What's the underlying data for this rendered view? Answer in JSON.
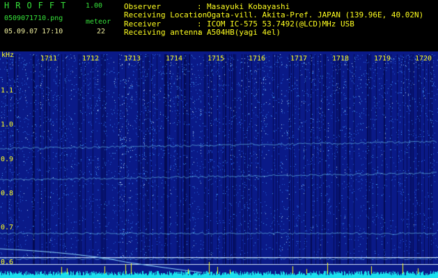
{
  "header": {
    "brand": "HROFFT",
    "version": "1.00",
    "filename": "0509071710.png",
    "object_type": "meteor",
    "datetime": "05.09.07 17:10",
    "count": "22"
  },
  "info": [
    {
      "label": "Observer",
      "value": "Masayuki Kobayashi"
    },
    {
      "label": "Receiving Location",
      "value": "Ogata-vill. Akita-Pref. JAPAN (139.96E, 40.02N)"
    },
    {
      "label": "Receiver",
      "value": "ICOM IC-575 53.7492(@LCD)MHz USB"
    },
    {
      "label": "Receiving antenna",
      "value": "A504HB(yagi 4el)"
    }
  ],
  "spectrogram": {
    "y_unit": "kHz",
    "y_ticks": [
      "1.1",
      "1.0",
      "0.9",
      "0.8",
      "0.7",
      "0.6"
    ],
    "x_ticks": [
      "1711",
      "1712",
      "1713",
      "1714",
      "1715",
      "1716",
      "1717",
      "1718",
      "1719",
      "1720"
    ],
    "colors": {
      "background": "#0a1a88",
      "noise": "#2a66e6",
      "bright": "#ffffff",
      "baseline": "#19e0ee",
      "marker": "#ffff20",
      "text": "#ffff20"
    }
  }
}
